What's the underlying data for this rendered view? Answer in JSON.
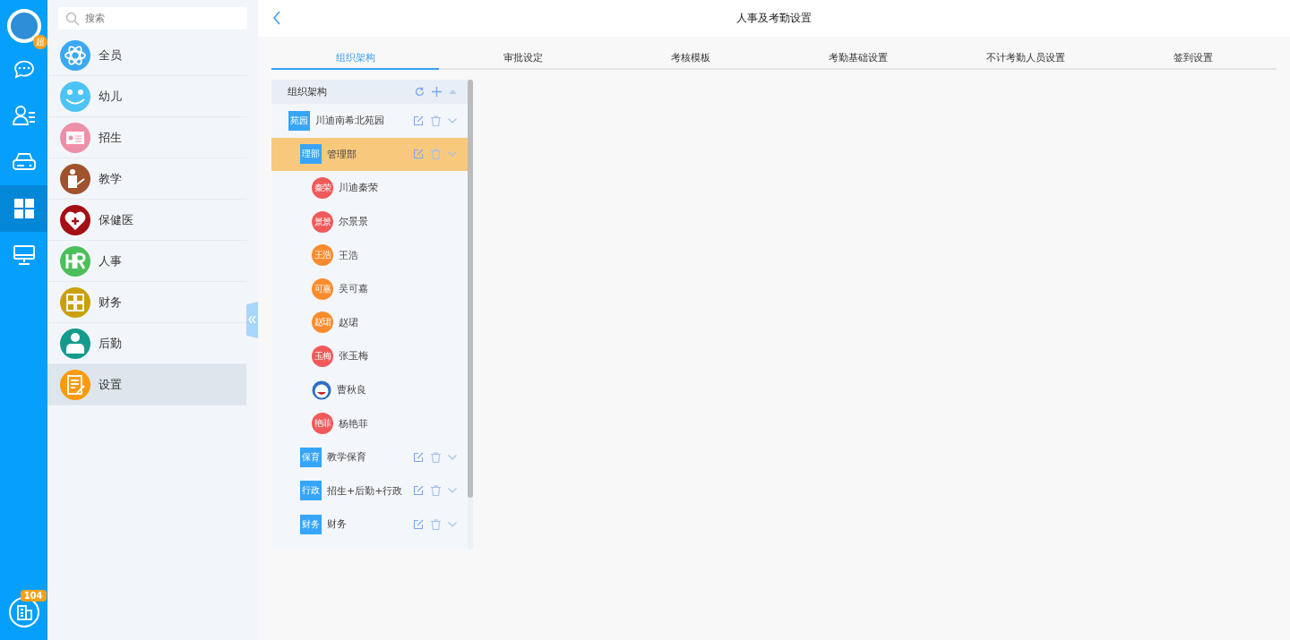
{
  "rail": {
    "avatar_badge": "超",
    "items": [
      {
        "kind": "chat",
        "selected": false
      },
      {
        "kind": "contacts",
        "selected": false
      },
      {
        "kind": "drive",
        "selected": false
      },
      {
        "kind": "apps",
        "selected": true
      },
      {
        "kind": "monitor",
        "selected": false
      }
    ],
    "bottom_badge": "104"
  },
  "menu": {
    "search": {
      "placeholder": "搜索"
    },
    "items": [
      {
        "label": "全员",
        "kind": "atom",
        "color": "#3aa8f5",
        "selected": false
      },
      {
        "label": "幼儿",
        "kind": "smile",
        "color": "#4cc4f5",
        "selected": false
      },
      {
        "label": "招生",
        "kind": "card",
        "color": "#ee8fa8",
        "selected": false
      },
      {
        "label": "教学",
        "kind": "teacher",
        "color": "#a0522d",
        "selected": false
      },
      {
        "label": "保健医",
        "kind": "heart",
        "color": "#a30f14",
        "selected": false
      },
      {
        "label": "人事",
        "kind": "hr",
        "color": "#4cbf5a",
        "selected": false
      },
      {
        "label": "财务",
        "kind": "calc",
        "color": "#c9a00a",
        "selected": false
      },
      {
        "label": "后勤",
        "kind": "person",
        "color": "#159a8e",
        "selected": false
      },
      {
        "label": "设置",
        "kind": "doc",
        "color": "#fb9a0a",
        "selected": true
      }
    ]
  },
  "header": {
    "title": "人事及考勤设置"
  },
  "tabs": [
    {
      "label": "组织架构",
      "selected": true
    },
    {
      "label": "审批设定",
      "selected": false
    },
    {
      "label": "考核模板",
      "selected": false
    },
    {
      "label": "考勤基础设置",
      "selected": false
    },
    {
      "label": "不计考勤人员设置",
      "selected": false
    },
    {
      "label": "签到设置",
      "selected": false
    }
  ],
  "tree": {
    "title": "组织架构",
    "nodes": [
      {
        "tag": "苑园",
        "name": "川迪南希北苑园",
        "selected": false,
        "children": [
          {
            "tag": "理部",
            "name": "管理部",
            "selected": true,
            "members": [
              {
                "kind": "initials",
                "initials": "秦荣",
                "name": "川迪秦荣",
                "color": "#f05a5a"
              },
              {
                "kind": "initials",
                "initials": "景景",
                "name": "尔景景",
                "color": "#f05a5a"
              },
              {
                "kind": "initials",
                "initials": "王浩",
                "name": "王浩",
                "color": "#fb8c2e"
              },
              {
                "kind": "initials",
                "initials": "可嘉",
                "name": "吴可嘉",
                "color": "#fb8c2e"
              },
              {
                "kind": "initials",
                "initials": "赵珺",
                "name": "赵珺",
                "color": "#fb8c2e"
              },
              {
                "kind": "initials",
                "initials": "玉梅",
                "name": "张玉梅",
                "color": "#f05a5a"
              },
              {
                "kind": "photo",
                "name": "曹秋良"
              },
              {
                "kind": "initials",
                "initials": "艳菲",
                "name": "杨艳菲",
                "color": "#f05a5a"
              }
            ]
          },
          {
            "tag": "保育",
            "name": "教学保育",
            "selected": false
          },
          {
            "tag": "行政",
            "name": "招生+后勤+行政",
            "selected": false
          },
          {
            "tag": "财务",
            "name": "财务",
            "selected": false
          }
        ]
      }
    ]
  }
}
